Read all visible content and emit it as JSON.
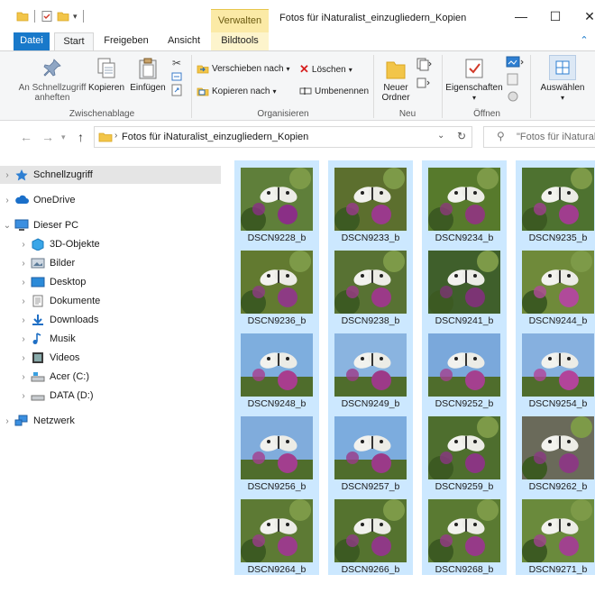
{
  "window": {
    "title": "Fotos für iNaturalist_einzugliedern_Kopien",
    "context_tab_header": "Verwalten",
    "minimize": "—",
    "maximize": "☐",
    "close": "✕"
  },
  "tabs": {
    "file": "Datei",
    "start": "Start",
    "share": "Freigeben",
    "view": "Ansicht",
    "picture_tools": "Bildtools",
    "collapse": "⌃"
  },
  "ribbon": {
    "pin_label": "An Schnellzugriff anheften",
    "copy_label": "Kopieren",
    "paste_label": "Einfügen",
    "clipboard_group": "Zwischenablage",
    "move_to_label": "Verschieben nach",
    "copy_to_label": "Kopieren nach",
    "delete_label": "Löschen",
    "rename_label": "Umbenennen",
    "organize_group": "Organisieren",
    "new_folder_label": "Neuer Ordner",
    "new_group": "Neu",
    "properties_label": "Eigenschaften",
    "open_group": "Öffnen",
    "select_label": "Auswählen"
  },
  "address": {
    "back": "←",
    "forward": "→",
    "up": "↑",
    "path": "Fotos für iNaturalist_einzugliedern_Kopien",
    "search_placeholder": "\"Fotos für iNatural..."
  },
  "nav": {
    "quick_access": "Schnellzugriff",
    "onedrive": "OneDrive",
    "this_pc": "Dieser PC",
    "objects3d": "3D-Objekte",
    "pictures": "Bilder",
    "desktop": "Desktop",
    "documents": "Dokumente",
    "downloads": "Downloads",
    "music": "Musik",
    "videos": "Videos",
    "drive_c": "Acer (C:)",
    "drive_d": "DATA (D:)",
    "network": "Netzwerk"
  },
  "files": [
    {
      "name": "DSCN9228_b",
      "bg": "#5f7f3a",
      "sky": false,
      "flower": "#8a2f86"
    },
    {
      "name": "DSCN9233_b",
      "bg": "#5c6f2e",
      "sky": false,
      "flower": "#9a3a8c"
    },
    {
      "name": "DSCN9234_b",
      "bg": "#577a2c",
      "sky": false,
      "flower": "#8c3a7a"
    },
    {
      "name": "DSCN9235_b",
      "bg": "#4e7230",
      "sky": false,
      "flower": "#a03d8e"
    },
    {
      "name": "DSCN9236_b",
      "bg": "#627a30",
      "sky": false,
      "flower": "#8d3b84"
    },
    {
      "name": "DSCN9238_b",
      "bg": "#587233",
      "sky": false,
      "flower": "#9b3a88"
    },
    {
      "name": "DSCN9241_b",
      "bg": "#3f5f2b",
      "sky": false,
      "flower": "#7c3474"
    },
    {
      "name": "DSCN9244_b",
      "bg": "#6f8a3a",
      "sky": false,
      "flower": "#b04a9a"
    },
    {
      "name": "DSCN9248_b",
      "bg": "#7eaede",
      "sky": true,
      "flower": "#a83d8e"
    },
    {
      "name": "DSCN9249_b",
      "bg": "#8ab4e0",
      "sky": true,
      "flower": "#9c3a88"
    },
    {
      "name": "DSCN9252_b",
      "bg": "#7aa8db",
      "sky": true,
      "flower": "#a4408f"
    },
    {
      "name": "DSCN9254_b",
      "bg": "#86b0df",
      "sky": true,
      "flower": "#b2449a"
    },
    {
      "name": "DSCN9256_b",
      "bg": "#80acdc",
      "sky": true,
      "flower": "#a23e8e"
    },
    {
      "name": "DSCN9257_b",
      "bg": "#7cacde",
      "sky": true,
      "flower": "#9a3a88"
    },
    {
      "name": "DSCN9259_b",
      "bg": "#4e6e2e",
      "sky": false,
      "flower": "#8a3682"
    },
    {
      "name": "DSCN9262_b",
      "bg": "#6a6a5a",
      "sky": false,
      "flower": "#8a3a82"
    },
    {
      "name": "DSCN9264_b",
      "bg": "#5d7a34",
      "sky": false,
      "flower": "#9a3c8a"
    },
    {
      "name": "DSCN9266_b",
      "bg": "#55732f",
      "sky": false,
      "flower": "#8f3986"
    },
    {
      "name": "DSCN9268_b",
      "bg": "#5a7a32",
      "sky": false,
      "flower": "#963a88"
    },
    {
      "name": "DSCN9271_b",
      "bg": "#6a8a3c",
      "sky": false,
      "flower": "#a0428e"
    }
  ]
}
